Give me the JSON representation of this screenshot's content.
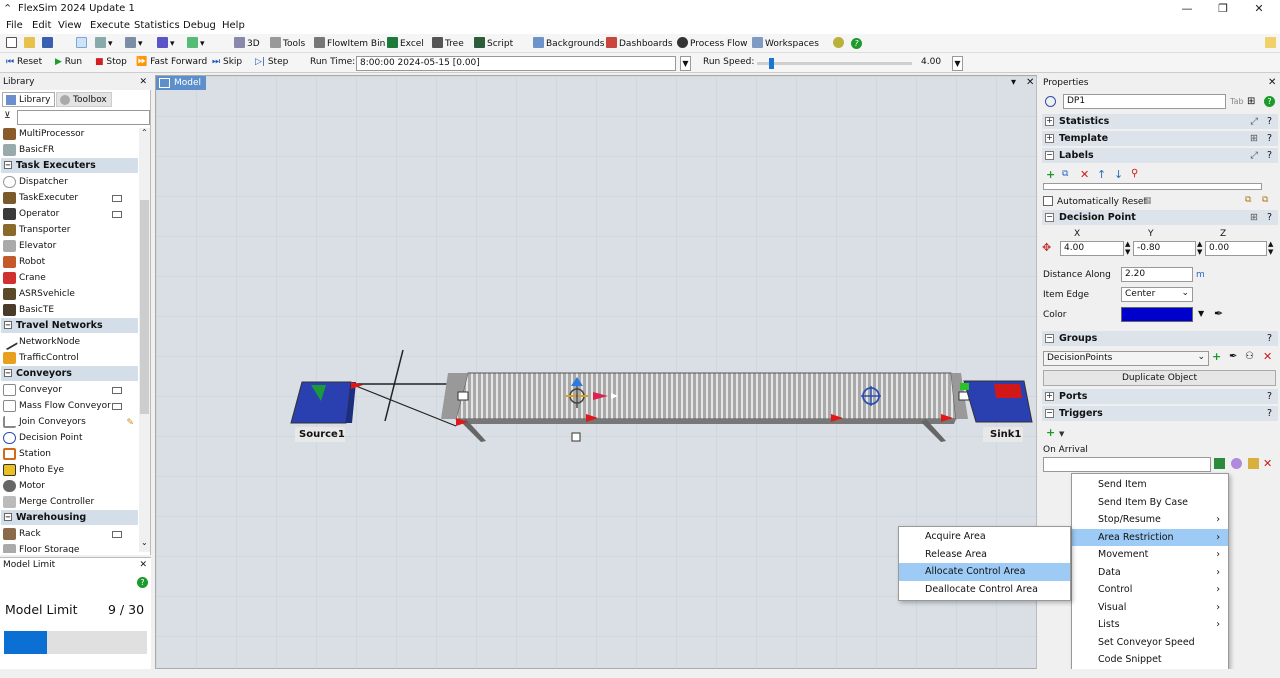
{
  "window": {
    "title": "FlexSim 2024 Update 1"
  },
  "menu": [
    "File",
    "Edit",
    "View",
    "Execute",
    "Statistics",
    "Debug",
    "Help"
  ],
  "toolbar": {
    "view3d": "3D",
    "tools": "Tools",
    "flowitem_bin": "FlowItem Bin",
    "excel": "Excel",
    "tree": "Tree",
    "script": "Script",
    "backgrounds": "Backgrounds",
    "dashboards": "Dashboards",
    "process_flow": "Process Flow",
    "workspaces": "Workspaces"
  },
  "runbar": {
    "reset": "Reset",
    "run": "Run",
    "stop": "Stop",
    "fast_forward": "Fast Forward",
    "skip": "Skip",
    "step": "Step",
    "run_time_label": "Run Time:",
    "run_time_value": "8:00:00  2024-05-15  [0.00]",
    "run_speed_label": "Run Speed:",
    "run_speed_value": "4.00"
  },
  "library": {
    "header": "Library",
    "tab_library": "Library",
    "tab_toolbox": "Toolbox",
    "filter_placeholder": "",
    "top_items": [
      "MultiProcessor",
      "BasicFR"
    ],
    "categories": [
      {
        "name": "Task Executers",
        "items": [
          "Dispatcher",
          "TaskExecuter",
          "Operator",
          "Transporter",
          "Elevator",
          "Robot",
          "Crane",
          "ASRSvehicle",
          "BasicTE"
        ]
      },
      {
        "name": "Travel Networks",
        "items": [
          "NetworkNode",
          "TrafficControl"
        ]
      },
      {
        "name": "Conveyors",
        "items": [
          "Conveyor",
          "Mass Flow Conveyor",
          "Join Conveyors",
          "Decision Point",
          "Station",
          "Photo Eye",
          "Motor",
          "Merge Controller"
        ]
      },
      {
        "name": "Warehousing",
        "items": [
          "Rack",
          "Floor Storage"
        ]
      }
    ]
  },
  "model_limit": {
    "header": "Model Limit",
    "label": "Model Limit",
    "value": "9 / 30",
    "fraction": 0.3
  },
  "model": {
    "tab": "Model",
    "source_label": "Source1",
    "sink_label": "Sink1"
  },
  "properties": {
    "header": "Properties",
    "object_name": "DP1",
    "sections": {
      "statistics": "Statistics",
      "template": "Template",
      "labels": "Labels",
      "decision_point": "Decision Point",
      "groups": "Groups",
      "ports": "Ports",
      "triggers": "Triggers"
    },
    "automatically_reset": "Automatically Reset",
    "x_label": "X",
    "y_label": "Y",
    "z_label": "Z",
    "x": "4.00",
    "y": "-0.80",
    "z": "0.00",
    "distance_along_label": "Distance Along",
    "distance_along": "2.20",
    "distance_unit": "m",
    "item_edge_label": "Item Edge",
    "item_edge": "Center",
    "color_label": "Color",
    "color": "#0000cc",
    "group_value": "DecisionPoints",
    "duplicate_object": "Duplicate Object",
    "on_arrival": "On Arrival"
  },
  "context_menu": {
    "items": [
      "Send Item",
      "Send Item By Case",
      "Stop/Resume",
      "Area Restriction",
      "Movement",
      "Data",
      "Control",
      "Visual",
      "Lists",
      "Set Conveyor Speed",
      "Code Snippet"
    ],
    "has_submenu": [
      false,
      false,
      true,
      true,
      true,
      true,
      true,
      true,
      true,
      false,
      false
    ],
    "selected_index": 3
  },
  "submenu": {
    "items": [
      "Acquire Area",
      "Release Area",
      "Allocate Control Area",
      "Deallocate Control Area"
    ],
    "selected_index": 2
  }
}
